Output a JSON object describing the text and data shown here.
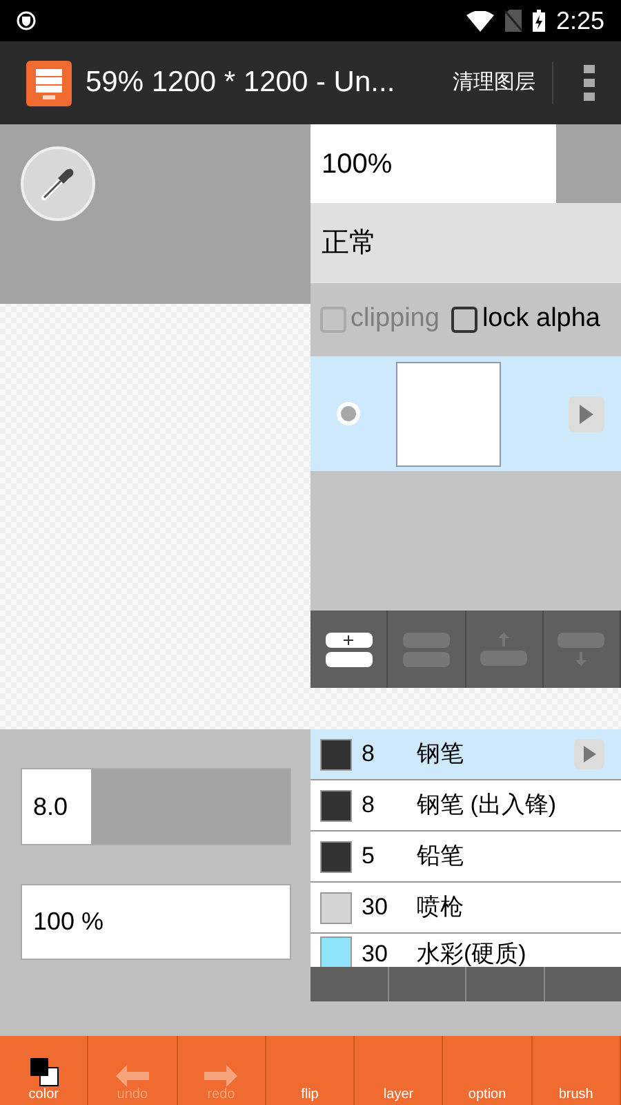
{
  "status_bar": {
    "time": "2:25"
  },
  "app_bar": {
    "title": "59% 1200 * 1200 - Un...",
    "action": "清理图层"
  },
  "layer_panel": {
    "opacity": "100%",
    "blend_mode": "正常",
    "options": [
      {
        "label": "clipping",
        "checked": false,
        "disabled": true
      },
      {
        "label": "lock alpha",
        "checked": false,
        "disabled": false
      }
    ],
    "layers": [
      {
        "visible": true,
        "selected": true
      }
    ],
    "buttons": [
      {
        "kind": "add",
        "disabled": false
      },
      {
        "kind": "delete",
        "disabled": true
      },
      {
        "kind": "up",
        "disabled": true
      },
      {
        "kind": "down",
        "disabled": true
      }
    ]
  },
  "brush_settings": {
    "size": "8.0",
    "level": 1,
    "opacity": "100 %"
  },
  "brushes": [
    {
      "size": "8",
      "name": "钢笔",
      "color": "#333333",
      "selected": true
    },
    {
      "size": "8",
      "name": "钢笔 (出入锋)",
      "color": "#333333",
      "selected": false
    },
    {
      "size": "5",
      "name": "铅笔",
      "color": "#333333",
      "selected": false
    },
    {
      "size": "30",
      "name": "喷枪",
      "color": "#d4d4d4",
      "selected": false
    },
    {
      "size": "30",
      "name": "水彩(硬质)",
      "color": "#8fe3fb",
      "selected": false
    }
  ],
  "toolbar": [
    {
      "kind": "color",
      "label": "color",
      "disabled": false
    },
    {
      "kind": "undo",
      "label": "undo",
      "disabled": true
    },
    {
      "kind": "redo",
      "label": "redo",
      "disabled": true
    },
    {
      "kind": "flip",
      "label": "flip",
      "disabled": false
    },
    {
      "kind": "layer",
      "label": "layer",
      "disabled": false
    },
    {
      "kind": "option",
      "label": "option",
      "disabled": false
    },
    {
      "kind": "brush",
      "label": "brush",
      "disabled": false
    }
  ]
}
